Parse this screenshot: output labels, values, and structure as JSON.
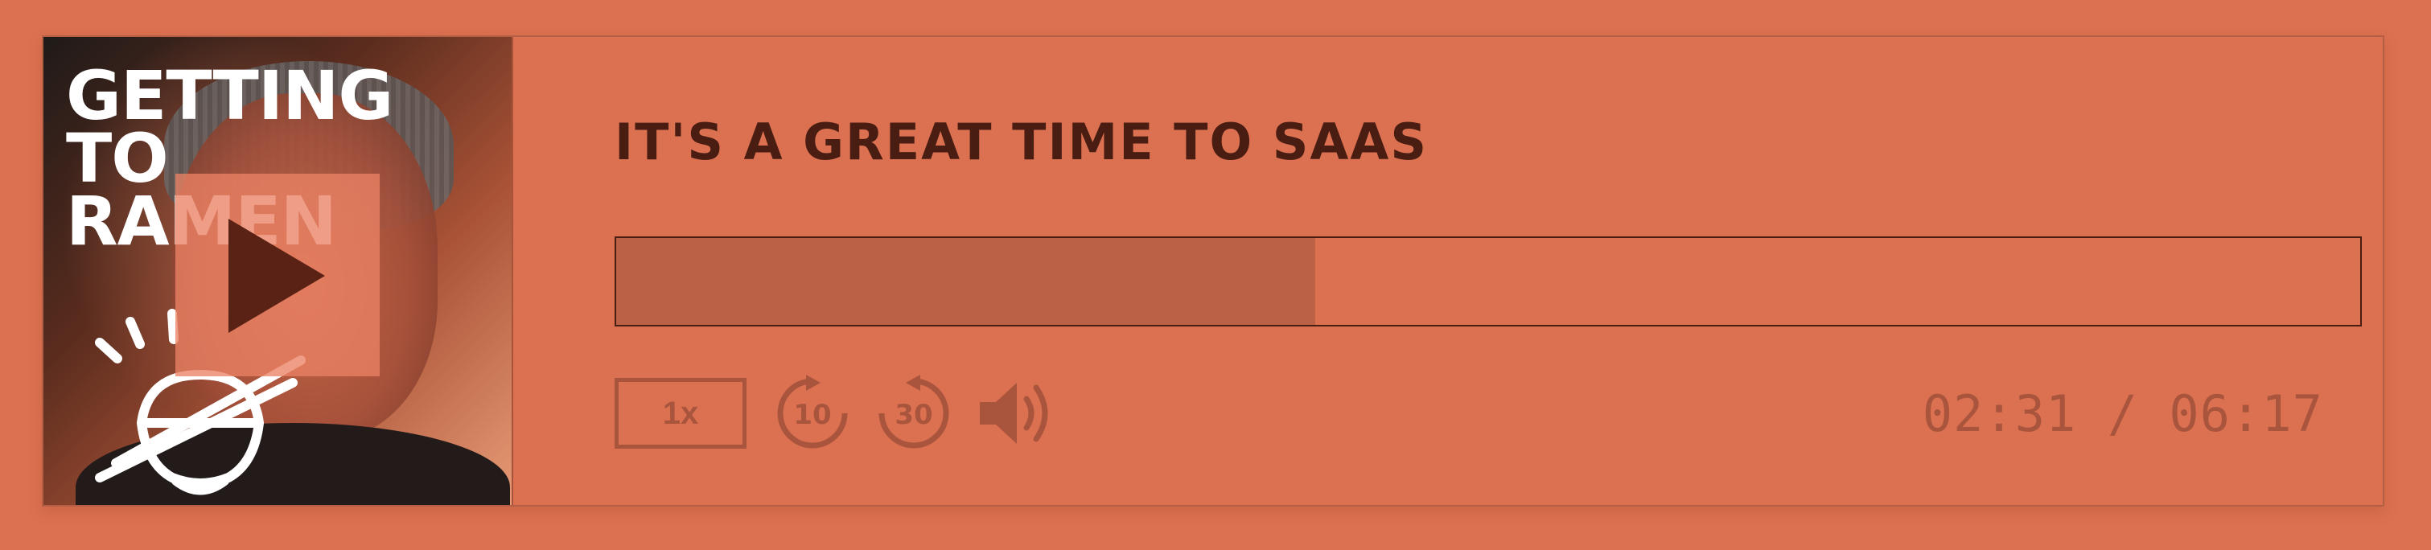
{
  "cover": {
    "show_name_lines": [
      "GETTING",
      "TO",
      "RAMEN"
    ],
    "play_icon": "play-icon",
    "logo_icon": "ramen-bowl-icon"
  },
  "episode": {
    "title": "IT'S A GREAT TIME TO SAAS"
  },
  "playback": {
    "progress": 0.401,
    "speed_label": "1x",
    "rewind_label": "10",
    "forward_label": "30",
    "rewind_icon": "rewind-10-icon",
    "forward_icon": "forward-30-icon",
    "volume_icon": "volume-icon",
    "time_display": "02:31 / 06:17"
  },
  "colors": {
    "background": "#dc7151",
    "title": "#4a1d12",
    "progress_fill": "#bb6145",
    "controls": "#a9553d"
  }
}
